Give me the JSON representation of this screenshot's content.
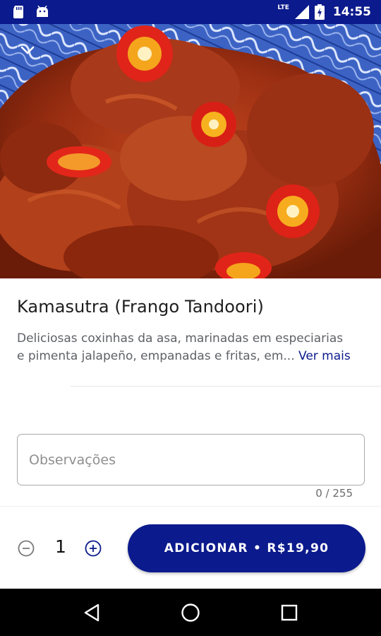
{
  "status_bar": {
    "time": "14:55",
    "network": "LTE",
    "icons": [
      "sd-card-icon",
      "android-icon",
      "signal-icon",
      "battery-icon"
    ]
  },
  "product": {
    "name": "Kamasutra (Frango Tandoori)",
    "description_line1": "Deliciosas coxinhas da asa, marinadas em especiarias",
    "description_line2": "e pimenta jalapeño, empanadas e fritas, em...",
    "see_more": "Ver mais"
  },
  "notes": {
    "placeholder": "Observações",
    "value": "",
    "counter": "0 / 255"
  },
  "order": {
    "quantity": "1",
    "add_label": "ADICIONAR • R$19,90"
  },
  "colors": {
    "brand": "#0b1a8c",
    "status_bar": "#0b1a8c"
  },
  "nav_bar": {
    "icons": [
      "back-triangle-icon",
      "home-circle-icon",
      "recents-square-icon"
    ]
  }
}
